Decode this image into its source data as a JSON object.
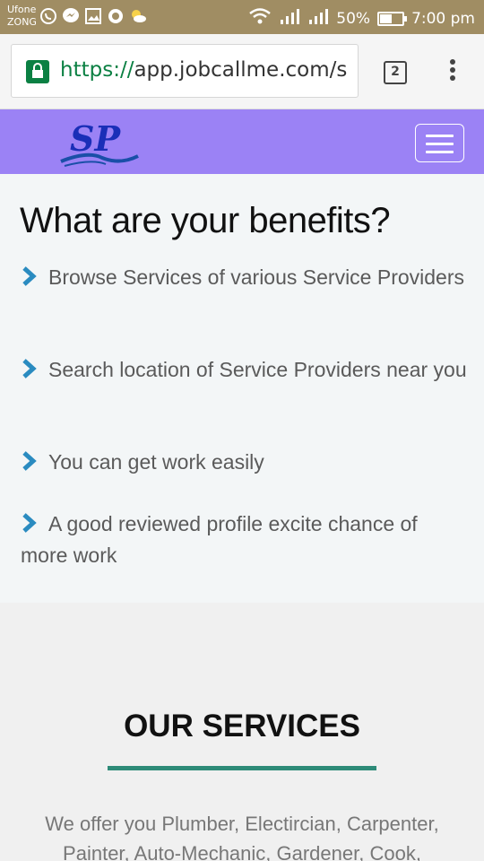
{
  "status_bar": {
    "carrier_1": "Ufone",
    "carrier_2": "ZONG",
    "battery": "50%",
    "time": "7:00 pm",
    "battery_level": 0.5,
    "icons": [
      "whatsapp-icon",
      "messenger-icon",
      "gallery-icon",
      "camera-icon",
      "weather-icon",
      "wifi-icon",
      "signal-icon",
      "signal-icon"
    ]
  },
  "browser": {
    "url_scheme": "https://",
    "url_rest": "app.jobcallme.com/s",
    "tab_count": "2"
  },
  "site": {
    "logo_text": "SP",
    "header_color": "#9b82f5"
  },
  "benefits": {
    "title": "What are your benefits?",
    "items": [
      "Browse Services of various Service Providers",
      "Search location of Service Providers near you",
      "You can get work easily",
      "A good reviewed profile excite chance of more work"
    ]
  },
  "services": {
    "title": "OUR SERVICES",
    "description": "We offer you Plumber, Electircian, Carpenter, Painter, Auto-Mechanic, Gardener, Cook,",
    "accent_color": "#2e8b78"
  }
}
